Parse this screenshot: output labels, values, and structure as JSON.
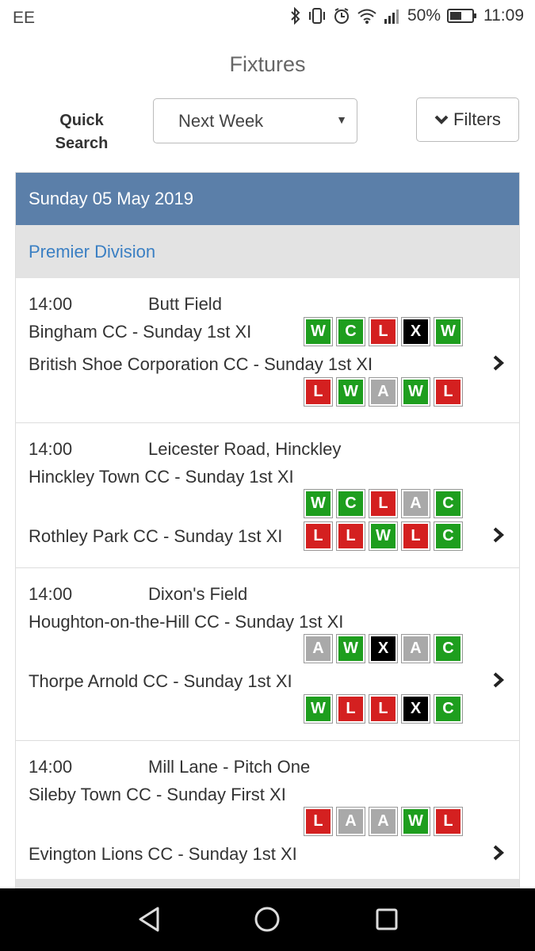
{
  "status_bar": {
    "carrier": "EE",
    "battery": "50%",
    "time": "11:09"
  },
  "page": {
    "title": "Fixtures"
  },
  "quick_search": {
    "label_line1": "Quick",
    "label_line2": "Search",
    "selected": "Next Week"
  },
  "filters": {
    "label": "Filters"
  },
  "date_header": "Sunday 05 May 2019",
  "division": "Premier Division",
  "fixtures": [
    {
      "time": "14:00",
      "venue": "Butt Field",
      "home": "Bingham CC - Sunday 1st XI",
      "home_form": [
        "W",
        "C",
        "L",
        "X",
        "W"
      ],
      "away": "British Shoe Corporation CC - Sunday 1st XI",
      "away_form": [
        "L",
        "W",
        "A",
        "W",
        "L"
      ]
    },
    {
      "time": "14:00",
      "venue": "Leicester Road, Hinckley",
      "home": "Hinckley Town CC - Sunday 1st XI",
      "home_form": [
        "W",
        "C",
        "L",
        "A",
        "C"
      ],
      "away": "Rothley Park CC - Sunday 1st XI",
      "away_form": [
        "L",
        "L",
        "W",
        "L",
        "C"
      ]
    },
    {
      "time": "14:00",
      "venue": "Dixon's Field",
      "home": "Houghton-on-the-Hill CC - Sunday 1st XI",
      "home_form": [
        "A",
        "W",
        "X",
        "A",
        "C"
      ],
      "away": "Thorpe Arnold CC - Sunday 1st XI",
      "away_form": [
        "W",
        "L",
        "L",
        "X",
        "C"
      ]
    },
    {
      "time": "14:00",
      "venue": "Mill Lane - Pitch One",
      "home": "Sileby Town CC - Sunday First XI",
      "home_form": [
        "L",
        "A",
        "A",
        "W",
        "L"
      ],
      "away": "Evington Lions CC - Sunday 1st XI",
      "away_form": []
    }
  ],
  "colors": {
    "win": "#1e9e1e",
    "loss": "#d42020",
    "abandoned": "#a9a9a9",
    "cancelled_x": "#000000",
    "date_bar": "#5b7fa9",
    "division_text": "#3a7fc3"
  },
  "icons": {
    "chevron": "chevron-right-icon",
    "filters": "chevron-down-icon",
    "nav": [
      "back-icon",
      "home-icon",
      "recents-icon"
    ]
  }
}
